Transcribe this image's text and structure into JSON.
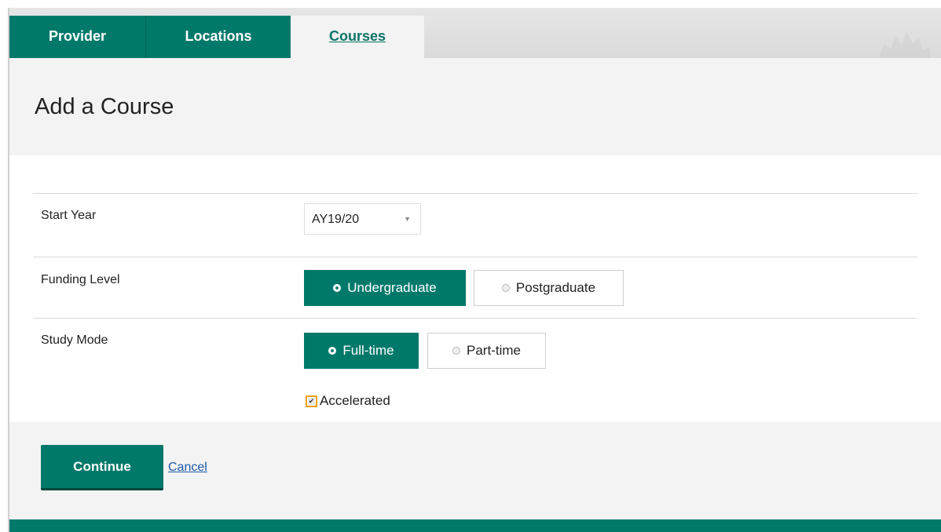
{
  "tabs": [
    {
      "label": "Provider",
      "active": false
    },
    {
      "label": "Locations",
      "active": false
    },
    {
      "label": "Courses",
      "active": true
    }
  ],
  "page": {
    "title": "Add a Course"
  },
  "form": {
    "start_year": {
      "label": "Start Year",
      "selected": "AY19/20"
    },
    "funding_level": {
      "label": "Funding Level",
      "options": [
        {
          "label": "Undergraduate",
          "selected": true
        },
        {
          "label": "Postgraduate",
          "selected": false
        }
      ]
    },
    "study_mode": {
      "label": "Study Mode",
      "options": [
        {
          "label": "Full-time",
          "selected": true
        },
        {
          "label": "Part-time",
          "selected": false
        }
      ]
    },
    "accelerated": {
      "label": "Accelerated",
      "checked": true
    }
  },
  "actions": {
    "continue_label": "Continue",
    "cancel_label": "Cancel"
  },
  "colors": {
    "primary": "#00796b",
    "panel_bg": "#f3f3f3",
    "link": "#1a57a8",
    "focus": "#f0a000"
  },
  "icons": {
    "select_arrow": "chevron-down-icon",
    "radio": "radio-icon",
    "checkbox": "checkbox-icon",
    "watermark": "maple-leaf-icon"
  }
}
